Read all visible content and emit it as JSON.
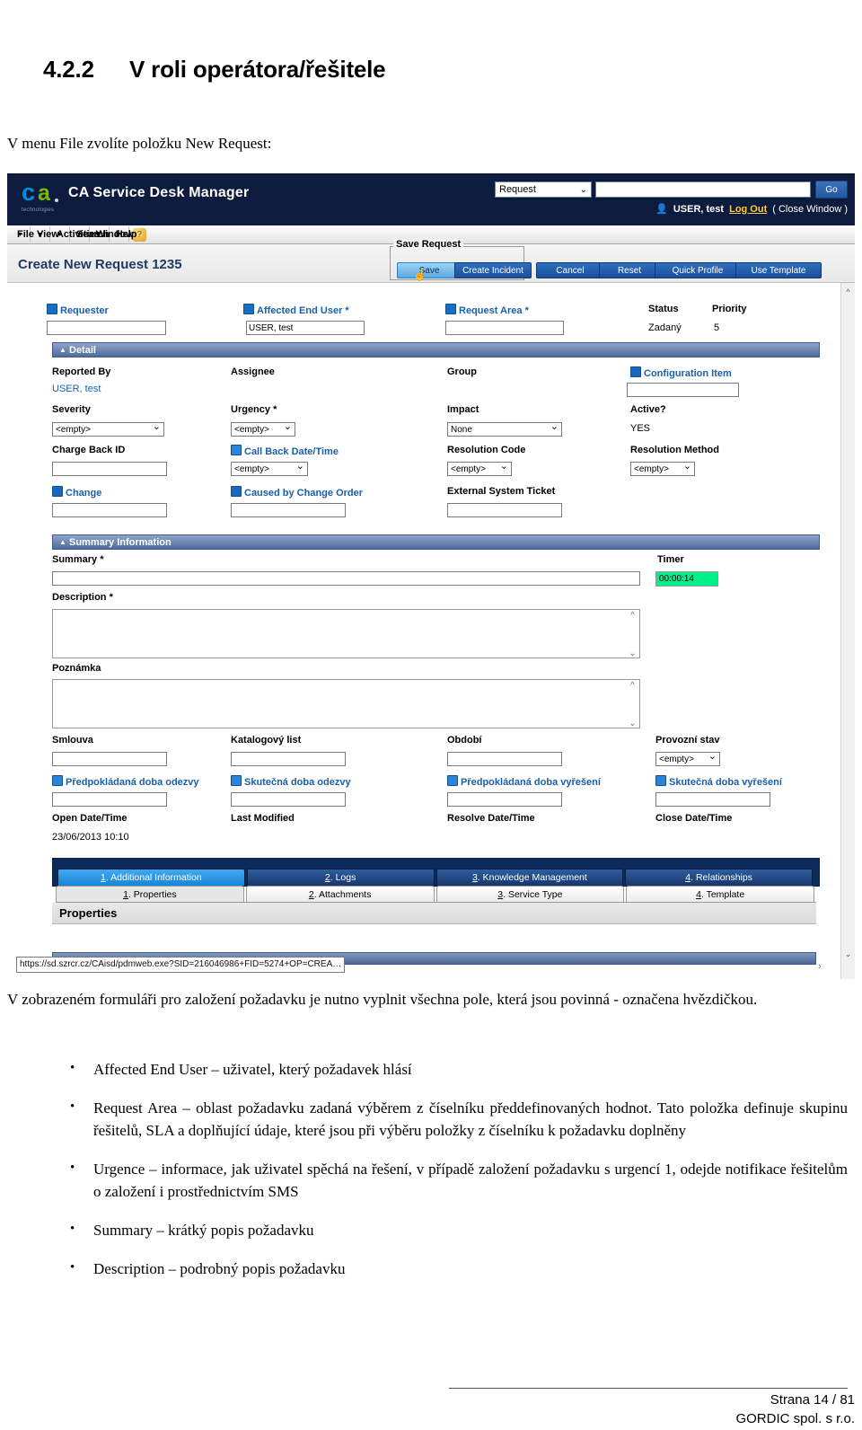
{
  "document": {
    "heading_number": "4.2.2",
    "heading_text": "V roli operátora/řešitele",
    "intro": "V menu File zvolíte položku New Request:",
    "paragraph": "V zobrazeném formuláři pro založení požadavku je nutno vyplnit všechna pole, která jsou povinná - označena hvězdičkou.",
    "bullets": [
      "Affected End User – uživatel, který požadavek hlásí",
      "Request Area – oblast požadavku zadaná výběrem z číselníku předdefinovaných hodnot. Tato položka definuje skupinu řešitelů, SLA a doplňující údaje, které jsou při výběru položky z číselníku k požadavku doplněny",
      "Urgence – informace, jak uživatel spěchá na řešení, v případě založení požadavku s urgencí 1, odejde notifikace řešitelům o založení i prostřednictvím SMS",
      "Summary – krátký popis požadavku",
      "Description – podrobný popis požadavku"
    ],
    "footer": {
      "page": "Strana 14 / 81",
      "company": "GORDIC spol. s r.o."
    }
  },
  "app": {
    "brand": {
      "logo_c": "c",
      "logo_a": "a",
      "tagline": "technologies",
      "title": "CA Service Desk Manager"
    },
    "header_search": {
      "scope_value": "Request",
      "query_value": "",
      "go_label": "Go"
    },
    "session": {
      "user": "USER, test",
      "logout": "Log Out",
      "close_window": "( Close Window )"
    },
    "menu": [
      {
        "label": "File",
        "accel": "F"
      },
      {
        "label": "View",
        "accel": "V"
      },
      {
        "label": "Activities",
        "accel": "A"
      },
      {
        "label": "Search",
        "accel": "e"
      },
      {
        "label": "Window",
        "accel": "W"
      },
      {
        "label": "Help",
        "accel": "H"
      }
    ],
    "action_bar": {
      "page_title": "Create New Request 1235",
      "save_group_label": "Save Request",
      "buttons": {
        "save": "Save",
        "create_incident": "Create Incident",
        "cancel": "Cancel",
        "reset": "Reset",
        "quick_profile": "Quick Profile",
        "use_template": "Use Template"
      }
    },
    "form": {
      "top_row": {
        "requester_label": "Requester",
        "requester_value": "",
        "affected_end_user_label": "Affected End User *",
        "affected_end_user_value": "USER, test",
        "request_area_label": "Request Area *",
        "request_area_value": "",
        "status_label": "Status",
        "status_value": "Zadaný",
        "priority_label": "Priority",
        "priority_value": "5"
      },
      "detail_section": "Detail",
      "detail": {
        "reported_by_label": "Reported By",
        "reported_by_value": "USER, test",
        "assignee_label": "Assignee",
        "assignee_value": "",
        "group_label": "Group",
        "group_value": "",
        "configuration_item_label": "Configuration Item",
        "configuration_item_value": "",
        "severity_label": "Severity",
        "severity_value": "<empty>",
        "urgency_label": "Urgency *",
        "urgency_value": "<empty>",
        "impact_label": "Impact",
        "impact_value": "None",
        "active_label": "Active?",
        "active_value": "YES",
        "charge_back_id_label": "Charge Back ID",
        "charge_back_id_value": "",
        "call_back_label": "Call Back Date/Time",
        "call_back_value": "<empty>",
        "resolution_code_label": "Resolution Code",
        "resolution_code_value": "<empty>",
        "resolution_method_label": "Resolution Method",
        "resolution_method_value": "<empty>",
        "change_label": "Change",
        "change_value": "",
        "caused_by_change_order_label": "Caused by Change Order",
        "caused_by_change_order_value": "",
        "external_system_ticket_label": "External System Ticket",
        "external_system_ticket_value": ""
      },
      "summary_section": "Summary Information",
      "summary": {
        "summary_label": "Summary *",
        "summary_value": "",
        "timer_label": "Timer",
        "timer_value": "00:00:14",
        "description_label": "Description *",
        "description_value": "",
        "poznamka_label": "Poznámka",
        "poznamka_value": "",
        "smlouva_label": "Smlouva",
        "smlouva_value": "",
        "katalogovy_list_label": "Katalogový list",
        "katalogovy_list_value": "",
        "obdobi_label": "Období",
        "obdobi_value": "",
        "provozni_stav_label": "Provozní stav",
        "provozni_stav_value": "<empty>",
        "predpokladana_odezvy_label": "Předpokládaná doba odezvy",
        "predpokladana_odezvy_value": "",
        "skutecna_odezvy_label": "Skutečná doba odezvy",
        "skutecna_odezvy_value": "",
        "predpokladana_vyreseni_label": "Předpokládaná doba vyřešení",
        "predpokladana_vyreseni_value": "",
        "skutecna_vyreseni_label": "Skutečná doba vyřešení",
        "skutecna_vyreseni_value": "",
        "open_date_label": "Open Date/Time",
        "open_date_value": "23/06/2013 10:10",
        "last_modified_label": "Last Modified",
        "last_modified_value": "",
        "resolve_date_label": "Resolve Date/Time",
        "resolve_date_value": "",
        "close_date_label": "Close Date/Time",
        "close_date_value": ""
      }
    },
    "tabs_primary": [
      {
        "num": "1",
        "label": ". Additional Information"
      },
      {
        "num": "2",
        "label": ". Logs"
      },
      {
        "num": "3",
        "label": ". Knowledge Management"
      },
      {
        "num": "4",
        "label": ". Relationships"
      }
    ],
    "tabs_secondary": [
      {
        "num": "1",
        "label": ". Properties"
      },
      {
        "num": "2",
        "label": ". Attachments"
      },
      {
        "num": "3",
        "label": ". Service Type"
      },
      {
        "num": "4",
        "label": ". Template"
      }
    ],
    "properties_title": "Properties",
    "status_url": "https://sd.szrcr.cz/CAisd/pdmweb.exe?SID=216046986+FID=5274+OP=CREA…"
  },
  "colors": {
    "header_navy": "#0d1b3e",
    "accent_blue": "#1a5fa8",
    "section_blue": "#4f6b9b",
    "timer_green": "#00f08a",
    "logout_yellow": "#ffcc33"
  }
}
